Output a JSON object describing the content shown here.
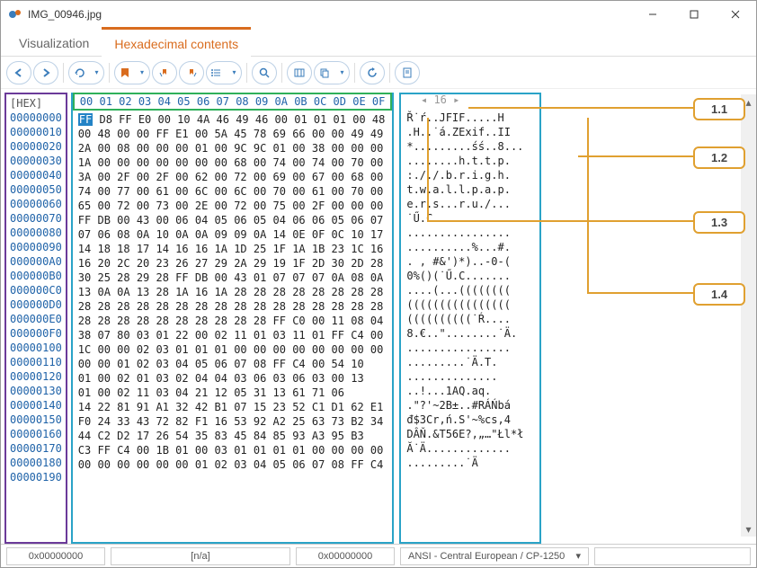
{
  "window": {
    "title": "IMG_00946.jpg"
  },
  "tabs": [
    {
      "label": "Visualization",
      "active": false
    },
    {
      "label": "Hexadecimal contents",
      "active": true
    }
  ],
  "toolbar_icons": [
    "back",
    "forward",
    "goto",
    "bookmark",
    "prev-bookmark",
    "next-bookmark",
    "list",
    "search",
    "columns",
    "copy",
    "refresh",
    "settings"
  ],
  "hex": {
    "header_label": "[HEX]",
    "col_header": "00 01 02 03 04 05 06 07 08 09 0A 0B 0C 0D 0E 0F",
    "width_label": "16",
    "offsets": [
      "00000000",
      "00000010",
      "00000020",
      "00000030",
      "00000040",
      "00000050",
      "00000060",
      "00000070",
      "00000080",
      "00000090",
      "000000A0",
      "000000B0",
      "000000C0",
      "000000D0",
      "000000E0",
      "000000F0",
      "00000100",
      "00000110",
      "00000120",
      "00000130",
      "00000140",
      "00000150",
      "00000160",
      "00000170",
      "00000180",
      "00000190"
    ],
    "rows": [
      " D8 FF E0 00 10 4A 46 49 46 00 01 01 01 00 48",
      "00 48 00 00 FF E1 00 5A 45 78 69 66 00 00 49 49",
      "2A 00 08 00 00 00 01 00 9C 9C 01 00 38 00 00 00",
      "1A 00 00 00 00 00 00 00 68 00 74 00 74 00 70 00",
      "3A 00 2F 00 2F 00 62 00 72 00 69 00 67 00 68 00",
      "74 00 77 00 61 00 6C 00 6C 00 70 00 61 00 70 00",
      "65 00 72 00 73 00 2E 00 72 00 75 00 2F 00 00 00",
      "FF DB 00 43 00 06 04 05 06 05 04 06 06 05 06 07",
      "07 06 08 0A 10 0A 0A 09 09 0A 14 0E 0F 0C 10 17",
      "14 18 18 17 14 16 16 1A 1D 25 1F 1A 1B 23 1C 16",
      "16 20 2C 20 23 26 27 29 2A 29 19 1F 2D 30 2D 28",
      "30 25 28 29 28 FF DB 00 43 01 07 07 07 0A 08 0A",
      "13 0A 0A 13 28 1A 16 1A 28 28 28 28 28 28 28 28",
      "28 28 28 28 28 28 28 28 28 28 28 28 28 28 28 28",
      "28 28 28 28 28 28 28 28 28 28 FF C0 00 11 08 04",
      "38 07 80 03 01 22 00 02 11 01 03 11 01 FF C4 00",
      "1C 00 00 02 03 01 01 01 00 00 00 00 00 00 00 00",
      "00 00 01 02 03 04 05 06 07 08 FF C4 00 54 10",
      "01 00 02 01 03 02 04 04 03 06 03 06 03 00 13",
      "01 00 02 11 03 04 21 12 05 31 13 61 71 06",
      "14 22 81 91 A1 32 42 B1 07 15 23 52 C1 D1 62 E1",
      "F0 24 33 43 72 82 F1 16 53 92 A2 25 63 73 B2 34",
      "44 C2 D2 17 26 54 35 83 45 84 85 93 A3 95 B3",
      "C3 FF C4 00 1B 01 00 03 01 01 01 01 00 00 00 00",
      "00 00 00 00 00 00 01 02 03 04 05 06 07 08 FF C4",
      ""
    ],
    "first_byte": "FF",
    "ascii": [
      "Ř˙ŕ..JFIF.....H",
      ".H..˙á.ZExif..II",
      "*.........śś..8...",
      "........h.t.t.p.",
      ":././.b.r.i.g.h.",
      "t.w.a.l.l.p.a.p.",
      "e.r.s...r.u./...",
      "˙Ű.C............",
      "................",
      "..........%...#.",
      ". , #&')*)..-0-(",
      "0%()(˙Ű.C.......",
      "....(...((((((((",
      "((((((((((((((((",
      "((((((((((˙Ŕ....",
      "8.€..\"........˙Ä.",
      "................",
      ".........˙Ä.T.",
      "..............",
      "..!...1AQ.aq.",
      ".\"?'~2B±..#RÁŃbá",
      "đ$3Cr,ń.S'~%cs,4",
      "DÂŇ.&T56E?,„…\"Łl*ł",
      "Ă˙Ä.............",
      ".........˙Ä",
      ""
    ]
  },
  "callouts": [
    {
      "label": "1.1"
    },
    {
      "label": "1.2"
    },
    {
      "label": "1.3"
    },
    {
      "label": "1.4"
    }
  ],
  "statusbar": {
    "offset": "0x00000000",
    "selection": "[n/a]",
    "cursor": "0x00000000",
    "encoding": "ANSI - Central European / CP-1250"
  }
}
